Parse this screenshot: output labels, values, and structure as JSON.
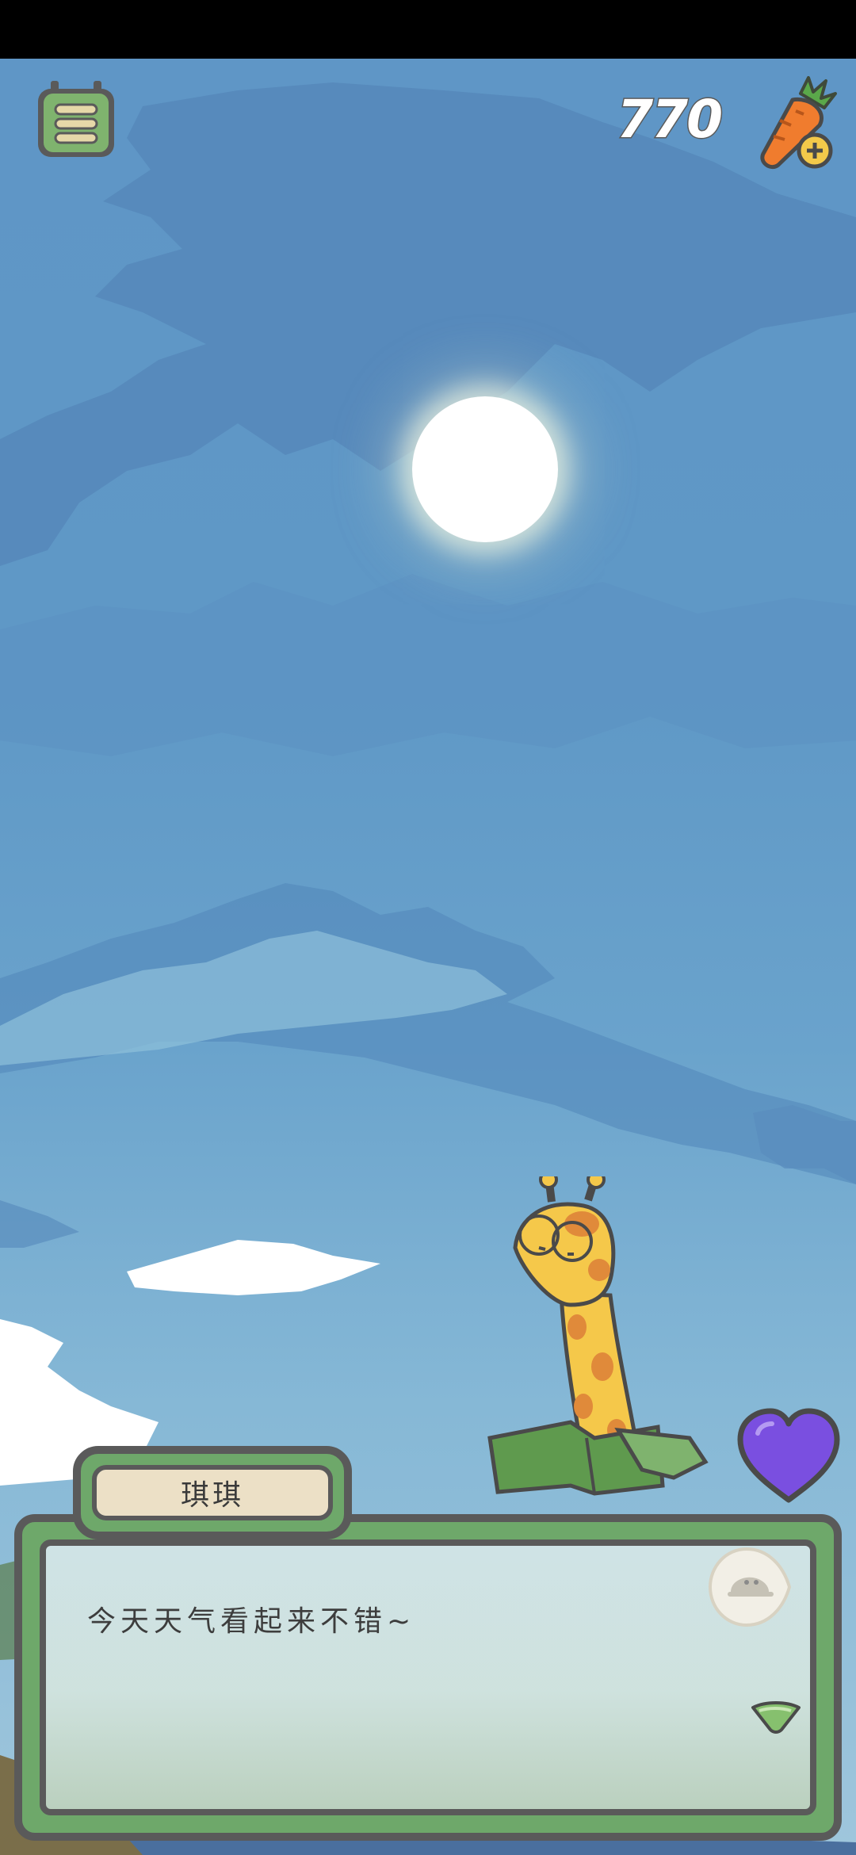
{
  "hud": {
    "carrot_count": "770"
  },
  "dialog": {
    "speaker": "琪琪",
    "message": "今天天气看起来不错~"
  },
  "colors": {
    "sky": "#5f96c6",
    "frame_green": "#6ea86a",
    "outline": "#5a5a5a",
    "heart": "#7a4fe0",
    "carrot": "#f07c2e"
  },
  "icons": [
    "menu-icon",
    "carrot-plus-icon",
    "heart-icon",
    "skip-icon",
    "next-arrow-icon"
  ]
}
